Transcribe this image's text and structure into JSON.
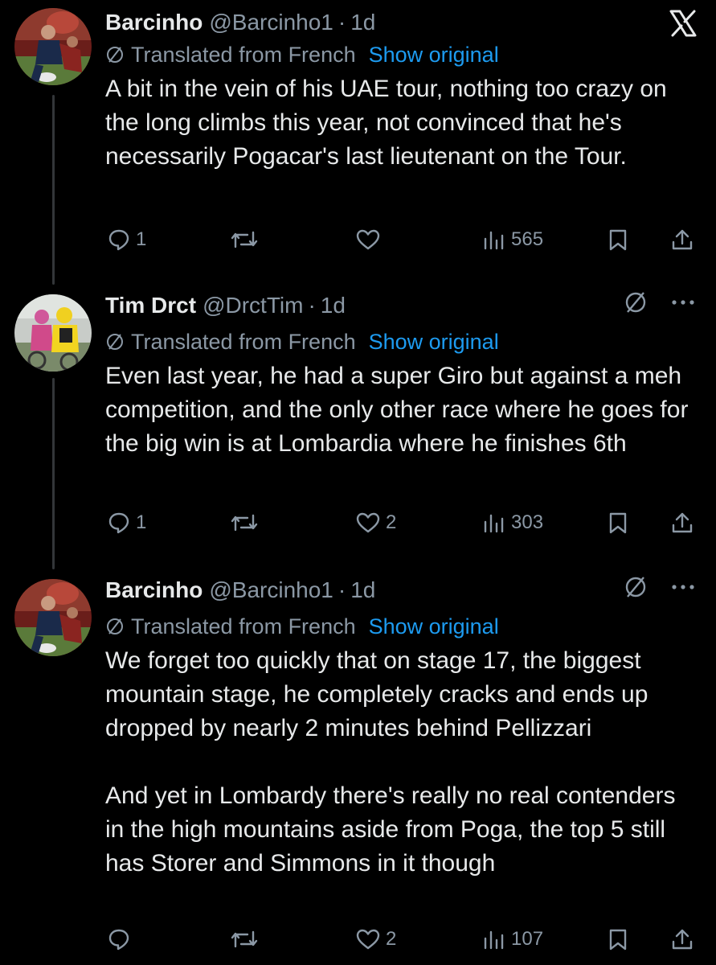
{
  "window": {
    "close_label": "X"
  },
  "tweets": [
    {
      "name": "Barcinho",
      "handle": "@Barcinho1",
      "sep": "·",
      "time": "1d",
      "translated": "Translated from French",
      "show_original": "Show original",
      "body": [
        "A bit in the vein of his UAE tour, nothing too crazy on the long climbs this year, not convinced that he's necessarily Pogacar's last lieutenant on the Tour."
      ],
      "replies": "1",
      "retweets": "",
      "likes": "",
      "views": "565"
    },
    {
      "name": "Tim Drct",
      "handle": "@DrctTim",
      "sep": "·",
      "time": "1d",
      "translated": "Translated from French",
      "show_original": "Show original",
      "body": [
        "Even last year, he had a super Giro but against a meh competition, and the only other race where he goes for the big win is at Lombardia where he finishes 6th"
      ],
      "replies": "1",
      "retweets": "",
      "likes": "2",
      "views": "303"
    },
    {
      "name": "Barcinho",
      "handle": "@Barcinho1",
      "sep": "·",
      "time": "1d",
      "translated": "Translated from French",
      "show_original": "Show original",
      "body": [
        "We forget too quickly that on stage 17, the biggest mountain stage, he completely cracks and ends up dropped by nearly 2 minutes behind Pellizzari",
        "And yet in Lombardy there's really no real contenders in the high mountains aside from Poga, the top 5 still has Storer and Simmons in it though"
      ],
      "replies": "",
      "retweets": "",
      "likes": "2",
      "views": "107"
    }
  ]
}
